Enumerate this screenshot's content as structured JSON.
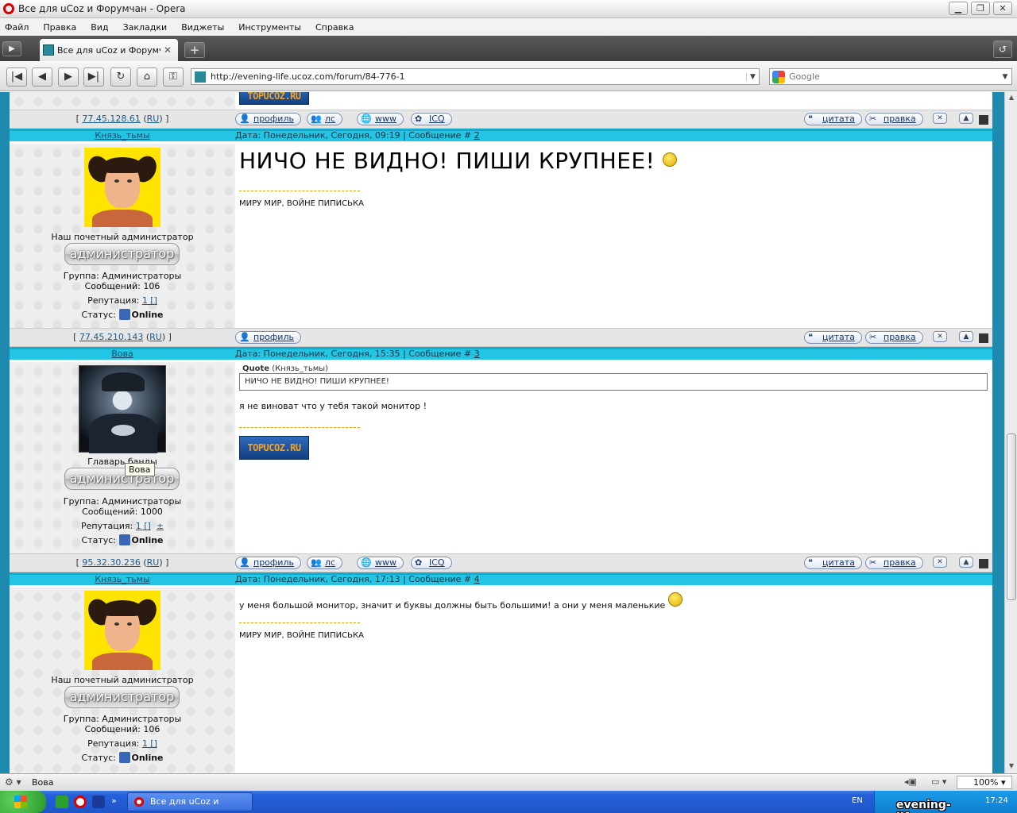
{
  "window": {
    "title": "Все для uCoz и Форумчан - Opera",
    "btn_min": "▁",
    "btn_max": "❐",
    "btn_close": "✕"
  },
  "menu": [
    "Файл",
    "Правка",
    "Вид",
    "Закладки",
    "Виджеты",
    "Инструменты",
    "Справка"
  ],
  "tabs": [
    {
      "label": "Все для uCoz и Форумч..."
    }
  ],
  "address": {
    "url": "http://evening-life.ucoz.com/forum/84-776-1"
  },
  "search": {
    "placeholder": "Google"
  },
  "posts": [
    {
      "ip": "77.45.128.61",
      "country": "RU",
      "buttons": {
        "profile": "профиль",
        "pm": "лс",
        "www": "www",
        "icq": "ICQ",
        "quote": "цитата",
        "edit": "правка"
      }
    },
    {
      "author": "Князь_тьмы",
      "date_prefix": "Дата: Понедельник, Сегодня, 09:19 | Сообщение #",
      "number": "2",
      "message": "НИЧО НЕ ВИДНО! ПИШИ КРУПНЕЕ!",
      "signature": "МИРУ МИР, ВОЙНЕ ПИПИСЬКА",
      "user_title": "Наш почетный администратор",
      "rank": "администратор",
      "group": "Группа: Администраторы",
      "messages_count": "Сообщений: 106",
      "rep_label": "Репутация:",
      "rep_value": "1 []",
      "status_label": "Статус:",
      "status_value": "Online",
      "ip": "77.45.210.143",
      "country": "RU",
      "buttons": {
        "profile": "профиль",
        "quote": "цитата",
        "edit": "правка"
      }
    },
    {
      "author": "Вова",
      "date_prefix": "Дата: Понедельник, Сегодня, 15:35 | Сообщение #",
      "number": "3",
      "quote_label": "Quote",
      "quote_author": "(Князь_тьмы)",
      "quote_text": "НИЧО НЕ ВИДНО! ПИШИ КРУПНЕЕ!",
      "message": "я не виноват что у тебя такой монитор !",
      "banner": "TOPUCOZ.RU",
      "user_title": "Главарь банды",
      "rank": "администратор",
      "group": "Группа: Администраторы",
      "messages_count": "Сообщений: 1000",
      "rep_label": "Репутация:",
      "rep_value": "1 []",
      "rep_plus": "±",
      "status_label": "Статус:",
      "status_value": "Online",
      "tooltip": "Вова",
      "ip": "95.32.30.236",
      "country": "RU",
      "buttons": {
        "profile": "профиль",
        "pm": "лс",
        "www": "www",
        "icq": "ICQ",
        "quote": "цитата",
        "edit": "правка"
      }
    },
    {
      "author": "Князь_тьмы",
      "date_prefix": "Дата: Понедельник, Сегодня, 17:13 | Сообщение #",
      "number": "4",
      "message": "у меня большой монитор, значит и буквы должны быть большими! а они у меня маленькие",
      "signature": "МИРУ МИР, ВОЙНЕ ПИПИСЬКА",
      "user_title": "Наш почетный администратор",
      "rank": "администратор",
      "group": "Группа: Администраторы",
      "messages_count": "Сообщений: 106",
      "rep_label": "Репутация:",
      "rep_value": "1 []",
      "status_label": "Статус:",
      "status_value": "Online"
    }
  ],
  "top_banner": "TOPUCOZ.RU",
  "statusbar": {
    "text": "Вова",
    "zoom": "100%"
  },
  "taskbar": {
    "task_label": "Все для uCoz и Фору...",
    "lang": "EN",
    "clock": "17:24"
  },
  "watermark": "evening-life.ucoz.com"
}
